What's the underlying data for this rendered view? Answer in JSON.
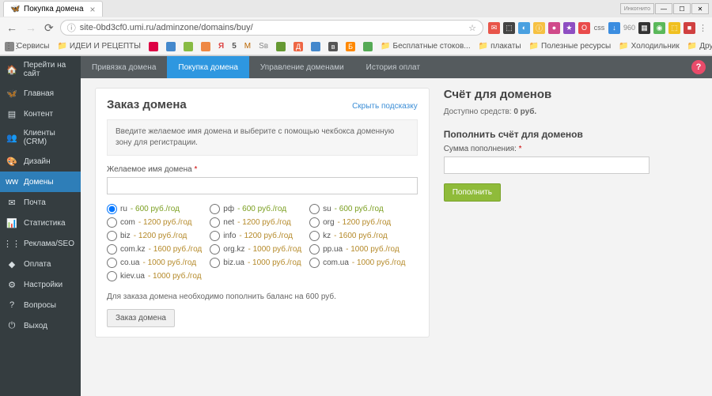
{
  "browser": {
    "tab_title": "Покупка домена",
    "url": "site-0bd3cf0.umi.ru/adminzone/domains/buy/",
    "win_incognito": "Инкогнито",
    "bookmarks": {
      "services": "Сервисы",
      "ideas": "ИДЕИ И РЕЦЕПТЫ",
      "stock": "Бесплатные стоков...",
      "posters": "плакаты",
      "resources": "Полезные ресурсы",
      "fridge": "Холодильник",
      "other": "Другие закладки"
    }
  },
  "sidebar": {
    "items": [
      {
        "label": "Перейти на сайт",
        "icon": "🏠"
      },
      {
        "label": "Главная",
        "icon": "🦋"
      },
      {
        "label": "Контент",
        "icon": "▤"
      },
      {
        "label": "Клиенты (CRM)",
        "icon": "👥"
      },
      {
        "label": "Дизайн",
        "icon": "🎨"
      },
      {
        "label": "Домены",
        "icon": "ww"
      },
      {
        "label": "Почта",
        "icon": "✉"
      },
      {
        "label": "Статистика",
        "icon": "📊"
      },
      {
        "label": "Реклама/SEO",
        "icon": "⋮⋮"
      },
      {
        "label": "Оплата",
        "icon": "◆"
      },
      {
        "label": "Настройки",
        "icon": "⚙"
      },
      {
        "label": "Вопросы",
        "icon": "?"
      },
      {
        "label": "Выход",
        "icon": "⏻"
      }
    ]
  },
  "topnav": {
    "items": [
      "Привязка домена",
      "Покупка домена",
      "Управление доменами",
      "История оплат"
    ]
  },
  "order": {
    "title": "Заказ домена",
    "hide_hint": "Скрыть подсказку",
    "intro": "Введите желаемое имя домена и выберите с помощью чекбокса доменную зону для регистрации.",
    "field_label": "Желаемое имя домена",
    "tlds": [
      {
        "name": "ru",
        "price": "- 600 руб./год",
        "cls": "g",
        "checked": true
      },
      {
        "name": "рф",
        "price": "- 600 руб./год",
        "cls": "g"
      },
      {
        "name": "su",
        "price": "- 600 руб./год",
        "cls": "g"
      },
      {
        "name": "",
        "price": ""
      },
      {
        "name": "com",
        "price": "- 1200 руб./год",
        "cls": "o"
      },
      {
        "name": "net",
        "price": "- 1200 руб./год",
        "cls": "o"
      },
      {
        "name": "org",
        "price": "- 1200 руб./год",
        "cls": "o"
      },
      {
        "name": "",
        "price": ""
      },
      {
        "name": "biz",
        "price": "- 1200 руб./год",
        "cls": "o"
      },
      {
        "name": "info",
        "price": "- 1200 руб./год",
        "cls": "o"
      },
      {
        "name": "kz",
        "price": "- 1600 руб./год",
        "cls": "o"
      },
      {
        "name": "",
        "price": ""
      },
      {
        "name": "com.kz",
        "price": "- 1600 руб./год",
        "cls": "o"
      },
      {
        "name": "org.kz",
        "price": "- 1000 руб./год",
        "cls": "o"
      },
      {
        "name": "pp.ua",
        "price": "- 1000 руб./год",
        "cls": "o"
      },
      {
        "name": "",
        "price": ""
      },
      {
        "name": "co.ua",
        "price": "- 1000 руб./год",
        "cls": "o"
      },
      {
        "name": "biz.ua",
        "price": "- 1000 руб./год",
        "cls": "o"
      },
      {
        "name": "com.ua",
        "price": "- 1000 руб./год",
        "cls": "o"
      },
      {
        "name": "",
        "price": ""
      },
      {
        "name": "kiev.ua",
        "price": "- 1000 руб./год",
        "cls": "o"
      }
    ],
    "balance_note": "Для заказа домена необходимо пополнить баланс на 600 руб.",
    "order_btn": "Заказ домена"
  },
  "account": {
    "title": "Счёт для доменов",
    "available_label": "Доступно средств:",
    "available_value": "0 руб.",
    "topup_title": "Пополнить счёт для доменов",
    "sum_label": "Сумма пополнения:",
    "topup_btn": "Пополнить"
  }
}
